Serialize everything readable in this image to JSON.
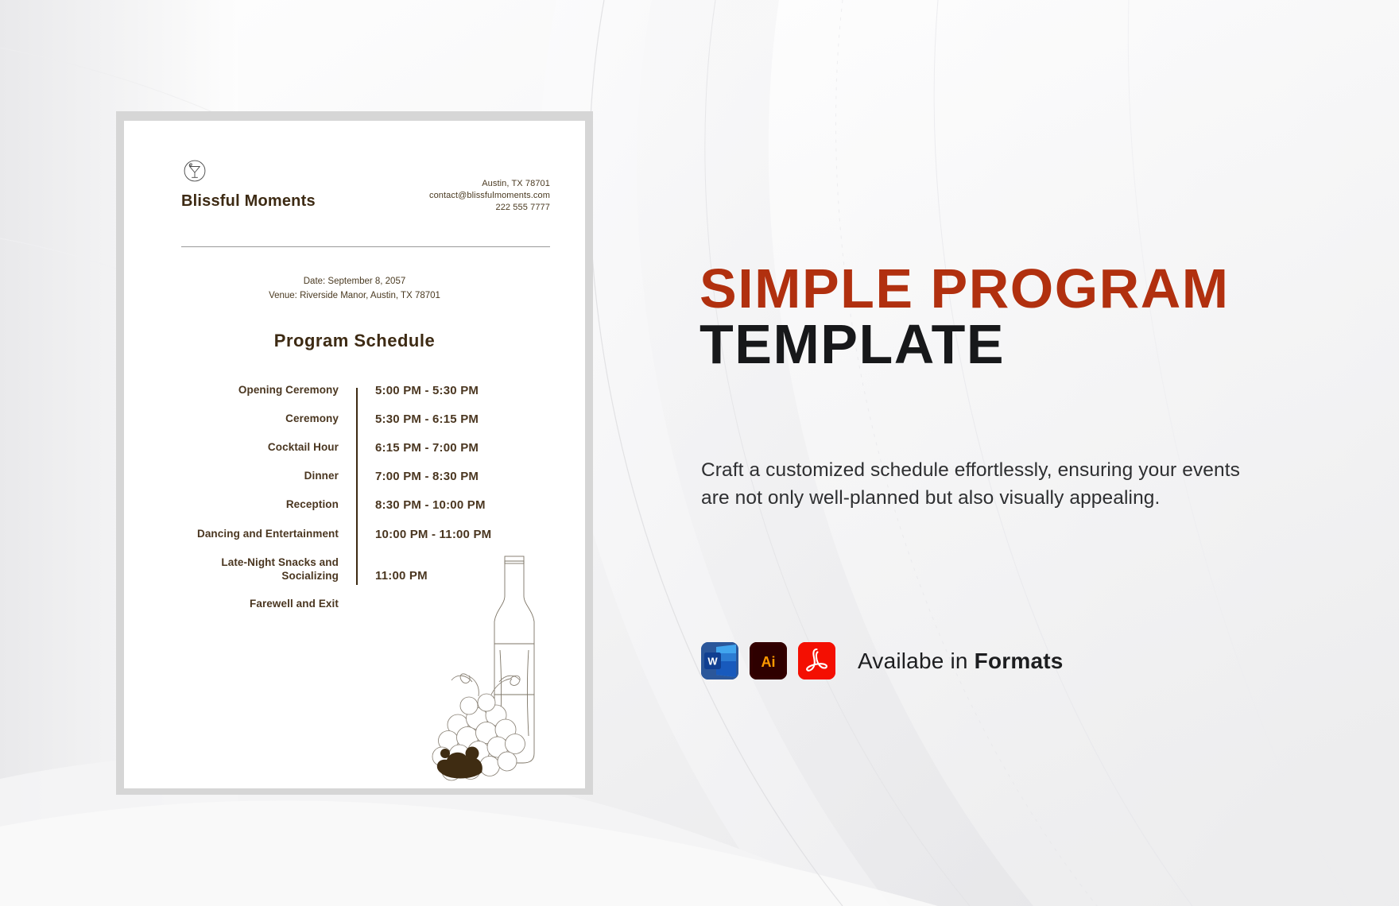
{
  "document": {
    "brand": {
      "name": "Blissful Moments",
      "logo_icon": "cocktail-glass-icon"
    },
    "contact": {
      "address": "Austin, TX 78701",
      "email": "contact@blissfulmoments.com",
      "phone": "222 555 7777"
    },
    "event": {
      "date_line": "Date: September 8, 2057",
      "venue_line": "Venue: Riverside Manor, Austin, TX 78701"
    },
    "schedule_title": "Program Schedule",
    "schedule": [
      {
        "label": "Opening Ceremony",
        "time": "5:00 PM - 5:30 PM"
      },
      {
        "label": "Ceremony",
        "time": "5:30 PM - 6:15 PM"
      },
      {
        "label": "Cocktail Hour",
        "time": "6:15 PM - 7:00 PM"
      },
      {
        "label": "Dinner",
        "time": "7:00 PM - 8:30 PM"
      },
      {
        "label": "Reception",
        "time": "8:30 PM - 10:00 PM"
      },
      {
        "label": "Dancing and Entertainment",
        "time": "10:00 PM - 11:00 PM"
      },
      {
        "label": "Late-Night Snacks and Socializing",
        "time": "11:00 PM"
      },
      {
        "label": "Farewell and Exit",
        "time": ""
      }
    ],
    "decoration": "wine-bottle-and-grapes-illustration"
  },
  "promo": {
    "title_line1": "SIMPLE PROGRAM",
    "title_line2": "TEMPLATE",
    "description": "Craft a customized schedule effortlessly, ensuring your events are not only well-planned but also visually appealing.",
    "formats_label_prefix": "Availabe in ",
    "formats_label_bold": "Formats",
    "formats": [
      {
        "name": "word-format-icon",
        "glyph": "W",
        "color": "#2b579a"
      },
      {
        "name": "illustrator-format-icon",
        "glyph": "Ai",
        "color": "#330000"
      },
      {
        "name": "pdf-format-icon",
        "glyph": "A",
        "color": "#f40f02"
      }
    ],
    "colors": {
      "accent_red": "#b1300f",
      "title_dark": "#17181a",
      "doc_text": "#4a3620"
    }
  }
}
